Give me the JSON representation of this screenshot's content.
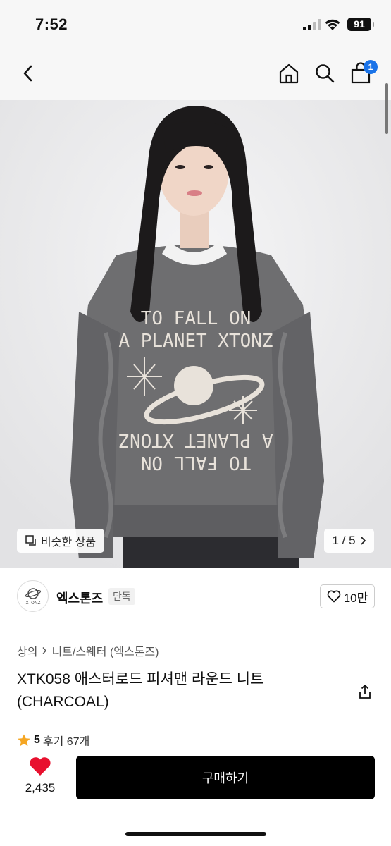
{
  "status_bar": {
    "time": "7:52",
    "battery_level": "91"
  },
  "nav": {
    "back_icon": "chevron-left-icon",
    "home_icon": "home-icon",
    "search_icon": "search-icon",
    "cart_icon": "shopping-bag-icon",
    "cart_badge": "1",
    "badge_color": "#1a73e8"
  },
  "image": {
    "similar_label": "비슷한 상품",
    "pager": "1 / 5",
    "print_text_line1": "TO FALL ON",
    "print_text_line2": "A PLANET XTONZ"
  },
  "brand": {
    "name": "엑스톤즈",
    "tag": "단독",
    "likes": "10만",
    "logo_text": "XTONZ"
  },
  "breadcrumb": {
    "category": "상의",
    "sub_category": "니트/스웨터 (엑스톤즈)"
  },
  "product": {
    "title": "XTK058 애스터로드 피셔맨 라운드 니트 (CHARCOAL)",
    "rating": "5",
    "reviews": "후기 67개"
  },
  "bottom": {
    "wish_count": "2,435",
    "buy_label": "구매하기",
    "heart_color": "#e8102e"
  }
}
